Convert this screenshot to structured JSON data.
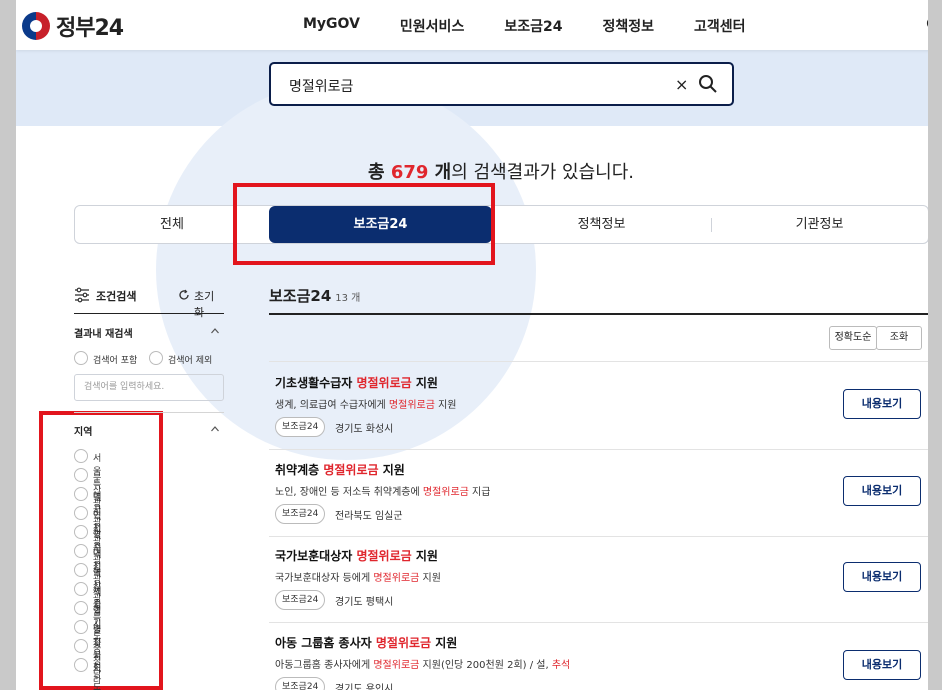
{
  "header": {
    "logo_text": "정부24",
    "nav": [
      "MyGOV",
      "민원서비스",
      "보조금24",
      "정책정보",
      "고객센터"
    ]
  },
  "search": {
    "value": "명절위로금",
    "clear_label": "×"
  },
  "results": {
    "prefix": "총 ",
    "count": "679",
    "unit": " 개",
    "suffix": "의 검색결과가 있습니다."
  },
  "tabs": [
    "전체",
    "보조금24",
    "정책정보",
    "기관정보"
  ],
  "active_tab": "보조금24",
  "sidebar": {
    "filter_label": "조건검색",
    "reset_label": "초기화",
    "refine_title": "결과내 재검색",
    "refine_options": [
      "검색어 포함",
      "검색어 제외"
    ],
    "refine_placeholder": "검색어를 입력하세요.",
    "region_title": "지역",
    "regions": [
      "서울특별시",
      "부산광역시",
      "대구광역시",
      "인천광역시",
      "광주광역시",
      "대전광역시",
      "울산광역시",
      "세종특별자치시",
      "경기도",
      "충청북도",
      "충청남도",
      "전라북도"
    ]
  },
  "main": {
    "title": "보조금24",
    "count": "13 개",
    "sort_label": "정확도순",
    "lookup_label": "조화",
    "items": [
      {
        "title_pre": "기초생활수급자 ",
        "title_hl": "명절위로금",
        "title_post": " 지원",
        "desc_pre": "생계, 의료급여 수급자에게 ",
        "desc_hl": "명절위로금",
        "desc_post": " 지원",
        "badge": "보조금24",
        "region": "경기도 화성시",
        "button": "내용보기"
      },
      {
        "title_pre": "취약계층 ",
        "title_hl": "명절위로금",
        "title_post": " 지원",
        "desc_pre": "노인, 장애인 등 저소득 취약계층에 ",
        "desc_hl": "명절위로금",
        "desc_post": " 지급",
        "badge": "보조금24",
        "region": "전라북도 임실군",
        "button": "내용보기"
      },
      {
        "title_pre": "국가보훈대상자 ",
        "title_hl": "명절위로금",
        "title_post": " 지원",
        "desc_pre": "국가보훈대상자 등에게 ",
        "desc_hl": "명절위로금",
        "desc_post": " 지원",
        "badge": "보조금24",
        "region": "경기도 평택시",
        "button": "내용보기"
      },
      {
        "title_pre": "아동 그룹홈 종사자 ",
        "title_hl": "명절위로금",
        "title_post": " 지원",
        "desc_pre": "아동그룹홈 종사자에게 ",
        "desc_hl": "명절위로금",
        "desc_post": " 지원(인당 200천원 2회) / 설, ",
        "desc_hl2": "추석",
        "badge": "보조금24",
        "region": "경기도 용인시",
        "button": "내용보기"
      }
    ]
  },
  "colors": {
    "primary": "#0b2d6f",
    "highlight": "#e0262d",
    "annotation": "#e2151d"
  }
}
